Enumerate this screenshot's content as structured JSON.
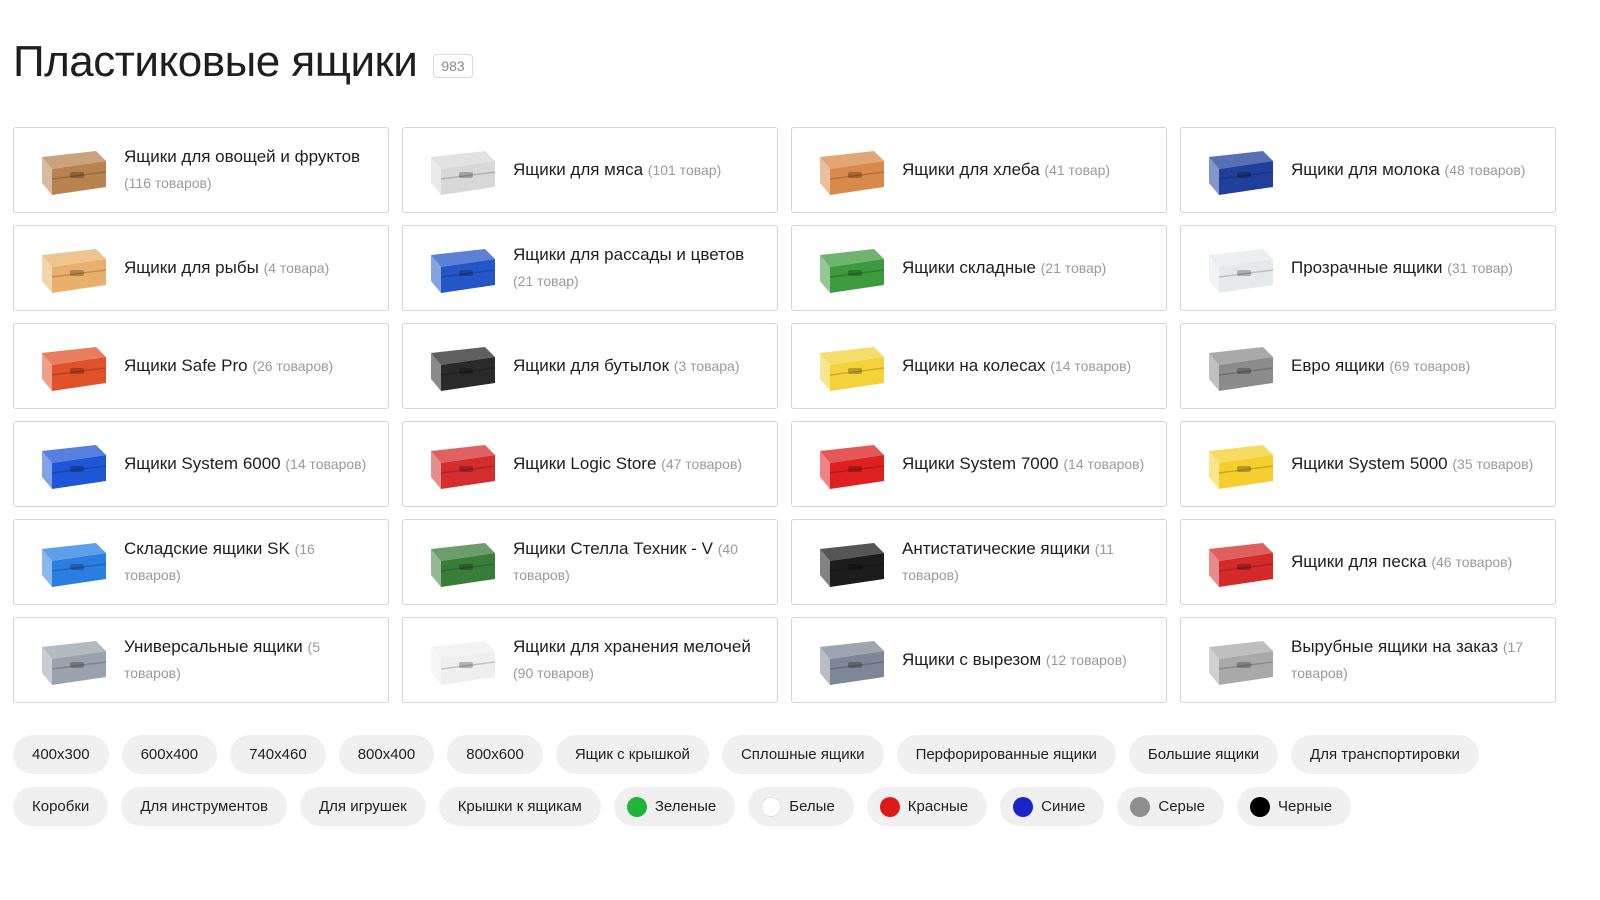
{
  "page": {
    "title": "Пластиковые ящики",
    "count": "983"
  },
  "categories": [
    {
      "name": "Ящики для овощей и фруктов",
      "count": "(116 товаров)",
      "icon": "vegetable-crate-icon",
      "color": "#b8834f"
    },
    {
      "name": "Ящики для мяса",
      "count": "(101 товар)",
      "icon": "meat-crate-icon",
      "color": "#d8d8d8"
    },
    {
      "name": "Ящики для хлеба",
      "count": "(41 товар)",
      "icon": "bread-crate-icon",
      "color": "#d98a4a"
    },
    {
      "name": "Ящики для молока",
      "count": "(48 товаров)",
      "icon": "milk-crate-icon",
      "color": "#1f3f9a"
    },
    {
      "name": "Ящики для рыбы",
      "count": "(4 товара)",
      "icon": "fish-crate-icon",
      "color": "#e8b06a"
    },
    {
      "name": "Ящики для рассады и цветов",
      "count": "(21 товар)",
      "icon": "seedling-tray-icon",
      "color": "#2456c8"
    },
    {
      "name": "Ящики складные",
      "count": "(21 товар)",
      "icon": "folding-crate-icon",
      "color": "#3e9a3e"
    },
    {
      "name": "Прозрачные ящики",
      "count": "(31 товар)",
      "icon": "transparent-box-icon",
      "color": "#e6e9ec"
    },
    {
      "name": "Ящики Safe Pro",
      "count": "(26 товаров)",
      "icon": "safe-pro-box-icon",
      "color": "#e0522a"
    },
    {
      "name": "Ящики для бутылок",
      "count": "(3 товара)",
      "icon": "bottle-crate-icon",
      "color": "#2a2a2a"
    },
    {
      "name": "Ящики на колесах",
      "count": "(14 товаров)",
      "icon": "wheeled-box-icon",
      "color": "#f3d23a"
    },
    {
      "name": "Евро ящики",
      "count": "(69 товаров)",
      "icon": "euro-box-icon",
      "color": "#8c8c8c"
    },
    {
      "name": "Ящики System 6000",
      "count": "(14 товаров)",
      "icon": "system-6000-bin-icon",
      "color": "#1e56d6"
    },
    {
      "name": "Ящики Logic Store",
      "count": "(47 товаров)",
      "icon": "logic-store-bin-icon",
      "color": "#d42d2d"
    },
    {
      "name": "Ящики System 7000",
      "count": "(14 товаров)",
      "icon": "system-7000-bin-icon",
      "color": "#de2020"
    },
    {
      "name": "Ящики System 5000",
      "count": "(35 товаров)",
      "icon": "system-5000-bin-icon",
      "color": "#f4cf2e"
    },
    {
      "name": "Складские ящики SK",
      "count": "(16 товаров)",
      "icon": "sk-warehouse-box-icon",
      "color": "#2a7ee0"
    },
    {
      "name": "Ящики Стелла Техник - V",
      "count": "(40 товаров)",
      "icon": "stella-rack-icon",
      "color": "#3a7d3a"
    },
    {
      "name": "Антистатические ящики",
      "count": "(11 товаров)",
      "icon": "antistatic-bin-icon",
      "color": "#1c1c1c"
    },
    {
      "name": "Ящики для песка",
      "count": "(46 товаров)",
      "icon": "sand-box-icon",
      "color": "#d42a2a"
    },
    {
      "name": "Универсальные ящики",
      "count": "(5 товаров)",
      "icon": "universal-box-icon",
      "color": "#9aa3ad"
    },
    {
      "name": "Ящики для хранения мелочей",
      "count": "(90 товаров)",
      "icon": "storage-container-icon",
      "color": "#efefef"
    },
    {
      "name": "Ящики с вырезом",
      "count": "(12 товаров)",
      "icon": "cutout-box-icon",
      "color": "#7d8797"
    },
    {
      "name": "Вырубные ящики на заказ",
      "count": "(17 товаров)",
      "icon": "custom-cut-box-icon",
      "color": "#a9a9a9"
    }
  ],
  "tags_row1": [
    "400x300",
    "600x400",
    "740x460",
    "800x400",
    "800x600",
    "Ящик с крышкой",
    "Сплошные ящики",
    "Перфорированные ящики",
    "Большие ящики",
    "Для транспортировки"
  ],
  "tags_row2": [
    {
      "label": "Коробки"
    },
    {
      "label": "Для инструментов"
    },
    {
      "label": "Для игрушек"
    },
    {
      "label": "Крышки к ящикам"
    },
    {
      "label": "Зеленые",
      "dot": "#1fb53a"
    },
    {
      "label": "Белые",
      "dot": "#ffffff"
    },
    {
      "label": "Красные",
      "dot": "#dd1a1a"
    },
    {
      "label": "Синие",
      "dot": "#1a24c8"
    },
    {
      "label": "Серые",
      "dot": "#8e8e8e"
    },
    {
      "label": "Черные",
      "dot": "#000000"
    }
  ]
}
